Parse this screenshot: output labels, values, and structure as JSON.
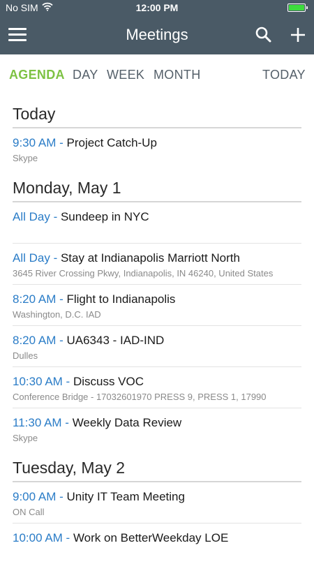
{
  "status_bar": {
    "carrier": "No SIM",
    "time": "12:00 PM",
    "battery_level": 1.0,
    "battery_color": "#3ddc3d"
  },
  "nav": {
    "title": "Meetings",
    "icons": [
      "menu-icon",
      "search-icon",
      "plus-icon"
    ]
  },
  "tabs": [
    {
      "label": "AGENDA",
      "active": true
    },
    {
      "label": "DAY",
      "active": false
    },
    {
      "label": "WEEK",
      "active": false
    },
    {
      "label": "MONTH",
      "active": false
    }
  ],
  "today_button": "TODAY",
  "colors": {
    "header_bg": "#4a5a66",
    "active_tab": "#7dc243",
    "time_blue": "#2a7cc7"
  },
  "sections": [
    {
      "header": "Today",
      "events": [
        {
          "time": "9:30 AM",
          "sep": " - ",
          "title": "Project Catch-Up",
          "location": "Skype"
        }
      ]
    },
    {
      "header": "Monday, May 1",
      "events": [
        {
          "time": "All Day",
          "sep": " - ",
          "title": "Sundeep in NYC",
          "location": ""
        },
        {
          "time": "All Day",
          "sep": " - ",
          "title": "Stay at Indianapolis Marriott North",
          "location": "3645 River Crossing Pkwy, Indianapolis, IN 46240, United States"
        },
        {
          "time": "8:20 AM",
          "sep": " - ",
          "title": "Flight to Indianapolis",
          "location": "Washington, D.C. IAD"
        },
        {
          "time": "8:20 AM",
          "sep": " - ",
          "title": "UA6343 - IAD-IND",
          "location": "Dulles"
        },
        {
          "time": "10:30 AM",
          "sep": " - ",
          "title": "Discuss VOC",
          "location": "Conference Bridge - 17032601970 PRESS 9, PRESS 1, 17990"
        },
        {
          "time": "11:30 AM",
          "sep": " - ",
          "title": "Weekly Data Review",
          "location": "Skype"
        }
      ]
    },
    {
      "header": "Tuesday, May 2",
      "events": [
        {
          "time": "9:00 AM",
          "sep": " - ",
          "title": "Unity IT Team Meeting",
          "location": "ON Call"
        },
        {
          "time": "10:00 AM",
          "sep": " - ",
          "title": "Work on BetterWeekday LOE",
          "location": ""
        }
      ]
    }
  ]
}
